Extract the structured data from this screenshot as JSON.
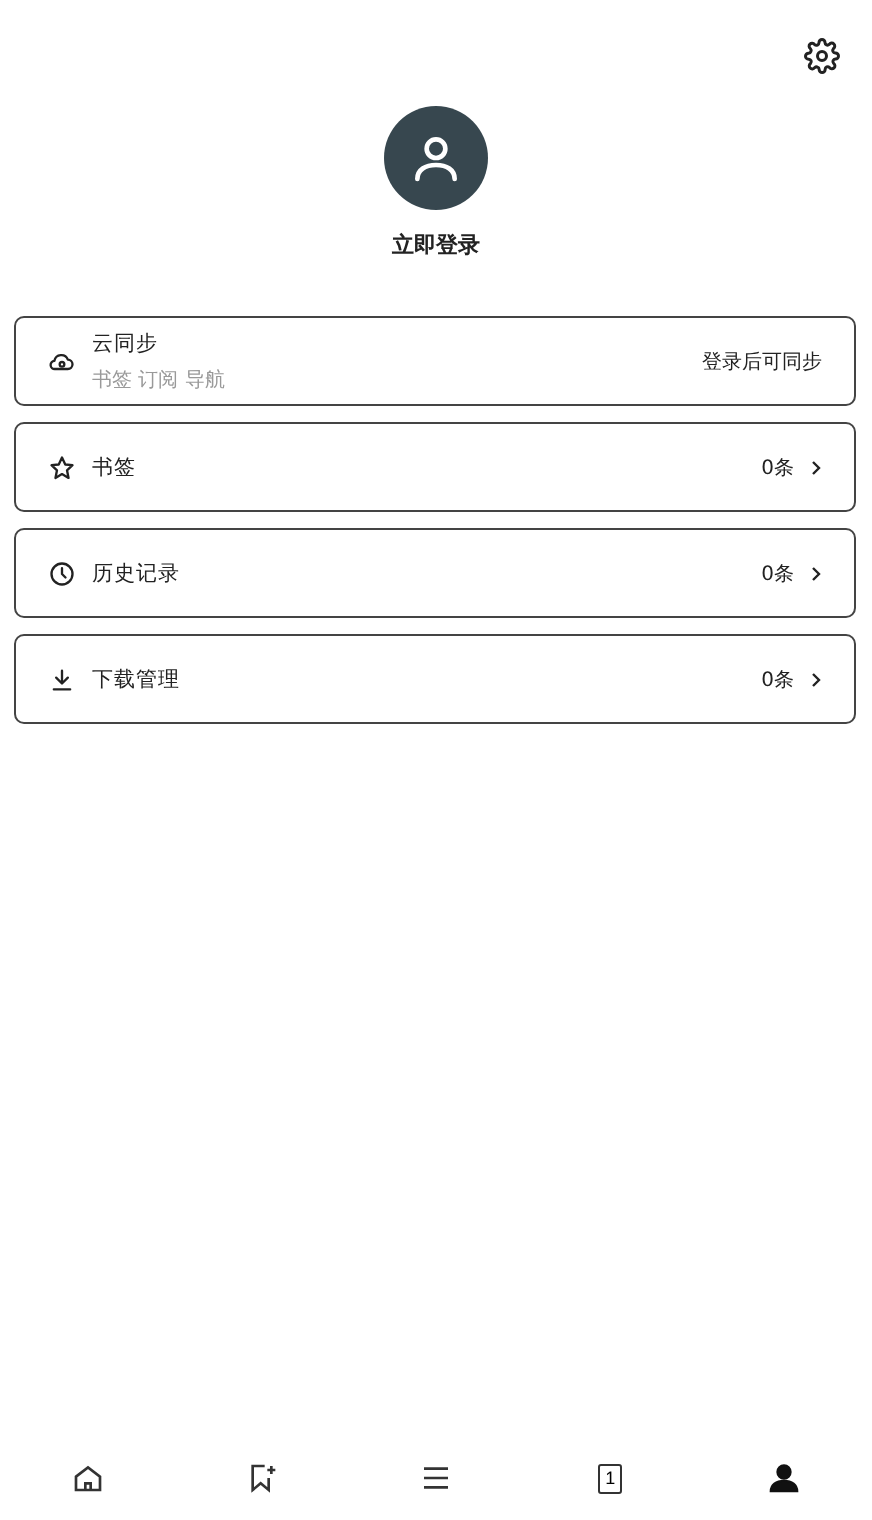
{
  "header": {
    "login_label": "立即登录"
  },
  "items": [
    {
      "kind": "sync",
      "title": "云同步",
      "subtitle": "书签 订阅 导航",
      "value": "登录后可同步",
      "chevron": false
    },
    {
      "kind": "star",
      "title": "书签",
      "value": "0条",
      "chevron": true
    },
    {
      "kind": "clock",
      "title": "历史记录",
      "value": "0条",
      "chevron": true
    },
    {
      "kind": "download",
      "title": "下载管理",
      "value": "0条",
      "chevron": true
    }
  ],
  "nav": [
    {
      "kind": "home",
      "selected": false
    },
    {
      "kind": "bookmark",
      "selected": false
    },
    {
      "kind": "menu",
      "selected": false
    },
    {
      "kind": "tabs",
      "count": "1",
      "selected": false
    },
    {
      "kind": "profile",
      "selected": true
    }
  ]
}
